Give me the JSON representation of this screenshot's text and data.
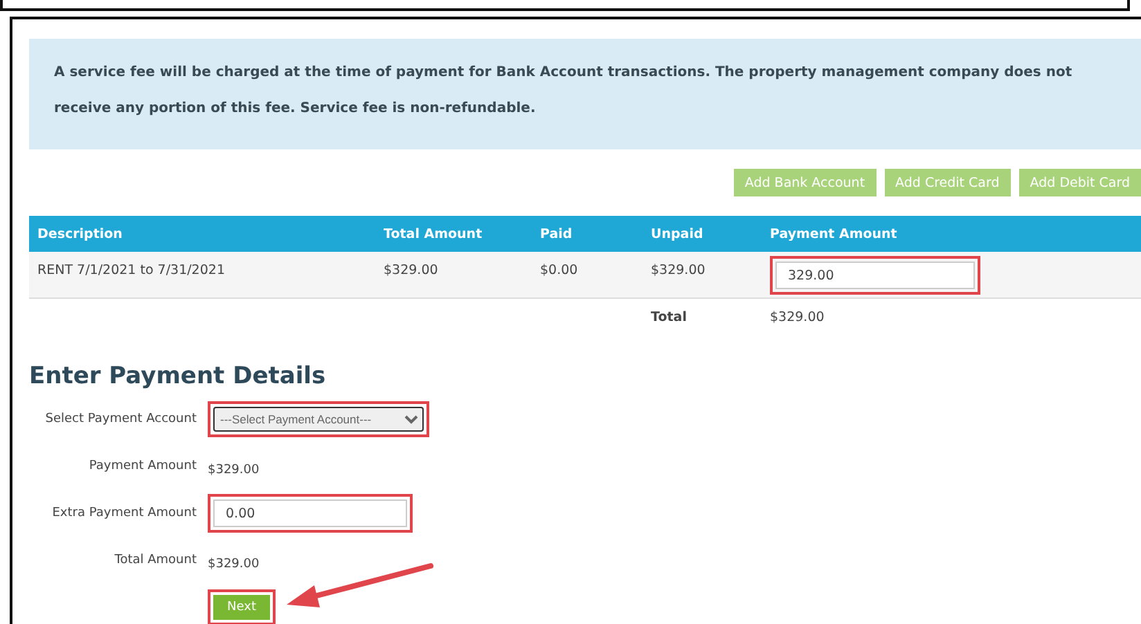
{
  "notice": "A service fee will be charged at the time of payment for Bank Account transactions. The property management company does not receive any portion of this fee. Service fee is non-refundable.",
  "account_buttons": [
    "Add Bank Account",
    "Add Credit Card",
    "Add Debit Card"
  ],
  "table": {
    "columns": [
      "Description",
      "Total Amount",
      "Paid",
      "Unpaid",
      "Payment Amount"
    ],
    "rows": [
      {
        "description": "RENT 7/1/2021 to 7/31/2021",
        "total_amount": "$329.00",
        "paid": "$0.00",
        "unpaid": "$329.00",
        "payment_amount": "329.00",
        "highlighted": true
      }
    ],
    "total": {
      "label": "Total",
      "value": "$329.00"
    }
  },
  "heading": "Enter Payment Details",
  "fields": [
    {
      "kind": "select",
      "label": "Select Payment Account",
      "value": "---Select Payment Account---",
      "highlighted": true
    },
    {
      "kind": "text",
      "label": "Payment Amount",
      "value": "$329.00"
    },
    {
      "kind": "input",
      "label": "Extra Payment Amount",
      "value": "0.00",
      "highlighted": true
    },
    {
      "kind": "text",
      "label": "Total Amount",
      "value": "$329.00"
    }
  ],
  "next_button": {
    "label": "Next",
    "highlighted": true
  }
}
